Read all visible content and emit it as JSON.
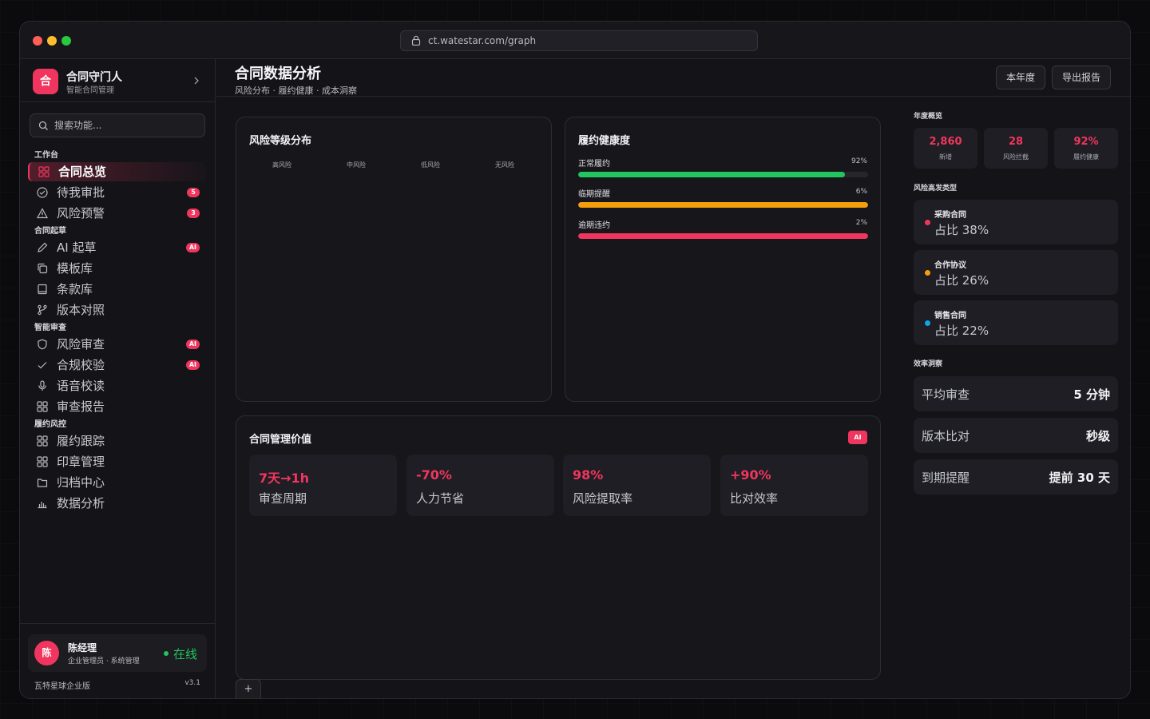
{
  "browser": {
    "url": "ct.watestar.com/graph"
  },
  "brand": {
    "logo": "合",
    "name": "合同守门人",
    "subtitle": "智能合同管理"
  },
  "search": {
    "placeholder": "搜索功能..."
  },
  "nav": {
    "groups": [
      {
        "label": "工作台"
      },
      {
        "label": "合同起草"
      },
      {
        "label": "智能审查"
      },
      {
        "label": "履约风控"
      }
    ],
    "items": [
      {
        "label": "合同总览",
        "icon": "grid-icon",
        "badge": ""
      },
      {
        "label": "待我审批",
        "icon": "check-circle-icon",
        "badge": "5"
      },
      {
        "label": "风险预警",
        "icon": "warning-icon",
        "badge": "3"
      },
      {
        "label": "AI 起草",
        "icon": "pen-icon",
        "badge": "AI"
      },
      {
        "label": "模板库",
        "icon": "copy-icon",
        "badge": ""
      },
      {
        "label": "条款库",
        "icon": "book-icon",
        "badge": ""
      },
      {
        "label": "版本对照",
        "icon": "git-branch-icon",
        "badge": ""
      },
      {
        "label": "风险审查",
        "icon": "shield-icon",
        "badge": "AI"
      },
      {
        "label": "合规校验",
        "icon": "check-icon",
        "badge": "AI"
      },
      {
        "label": "语音校读",
        "icon": "mic-icon",
        "badge": ""
      },
      {
        "label": "审查报告",
        "icon": "grid-icon",
        "badge": ""
      },
      {
        "label": "履约跟踪",
        "icon": "grid-icon",
        "badge": ""
      },
      {
        "label": "印章管理",
        "icon": "grid-icon",
        "badge": ""
      },
      {
        "label": "归档中心",
        "icon": "folder-icon",
        "badge": ""
      },
      {
        "label": "数据分析",
        "icon": "bar-chart-icon",
        "badge": ""
      }
    ]
  },
  "user": {
    "avatar": "陈",
    "name": "陈经理",
    "role": "企业管理员 · 系统管理",
    "status": "在线"
  },
  "footer": {
    "edition": "瓦特星球企业版",
    "version": "v3.1"
  },
  "header": {
    "title": "合同数据分析",
    "subtitle": "风险分布 · 履约健康 · 成本洞察",
    "buttons": [
      "本年度",
      "导出报告"
    ]
  },
  "risk_panel": {
    "title": "风险等级分布",
    "columns": [
      "高风险",
      "中风险",
      "低风险",
      "无风险"
    ]
  },
  "health_panel": {
    "title": "履约健康度",
    "rows": [
      {
        "label": "正常履约",
        "pct_text": "92%",
        "value": 92,
        "color": "#22c55e"
      },
      {
        "label": "临期提醒",
        "pct_text": "6%",
        "value": 100,
        "color": "#f59e0b"
      },
      {
        "label": "逾期违约",
        "pct_text": "2%",
        "value": 100,
        "color": "#f0365e"
      }
    ]
  },
  "value_panel": {
    "title": "合同管理价值",
    "tag": "AI",
    "cards": [
      {
        "value": "7天→1h",
        "label": "审查周期"
      },
      {
        "value": "-70%",
        "label": "人力节省"
      },
      {
        "value": "98%",
        "label": "风险提取率"
      },
      {
        "value": "+90%",
        "label": "比对效率"
      }
    ]
  },
  "tab_add": "+",
  "overview": {
    "label": "年度概览",
    "stats": [
      {
        "value": "2,860",
        "label": "新增"
      },
      {
        "value": "28",
        "label": "风险拦截"
      },
      {
        "value": "92%",
        "label": "履约健康"
      }
    ]
  },
  "risk_types": {
    "label": "风险高发类型",
    "items": [
      {
        "name": "采购合同",
        "pct": "占比 38%",
        "color": "#f0365e"
      },
      {
        "name": "合作协议",
        "pct": "占比 26%",
        "color": "#f59e0b"
      },
      {
        "name": "销售合同",
        "pct": "占比 22%",
        "color": "#0ea5e9"
      }
    ]
  },
  "efficiency": {
    "label": "效率洞察",
    "items": [
      {
        "label": "平均审查",
        "value": "5 分钟"
      },
      {
        "label": "版本比对",
        "value": "秒级"
      },
      {
        "label": "到期提醒",
        "value": "提前 30 天"
      }
    ]
  }
}
